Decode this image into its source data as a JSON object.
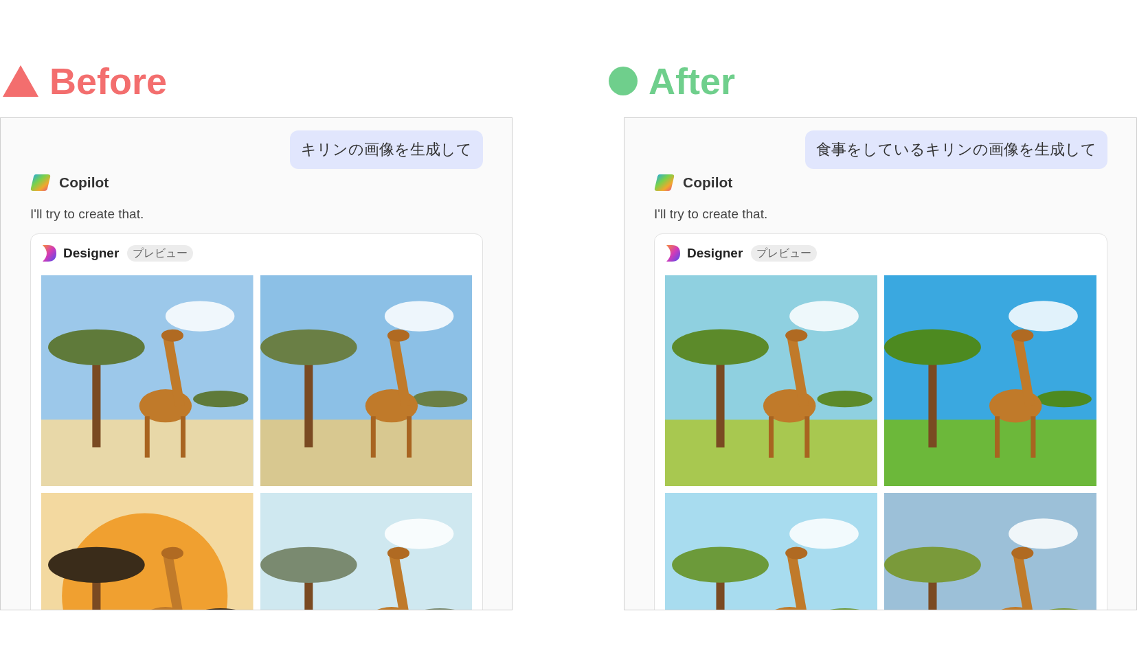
{
  "panels": [
    {
      "heading": "Before",
      "kind": "triangle",
      "color": "#f36e6e",
      "prompt": "キリンの画像を生成して",
      "assistant": "Copilot",
      "reply": "I'll try to create that.",
      "card": {
        "title": "Designer",
        "badge": "プレビュー"
      }
    },
    {
      "heading": "After",
      "kind": "circle",
      "color": "#6fcf8c",
      "prompt": "食事をしているキリンの画像を生成して",
      "assistant": "Copilot",
      "reply": "I'll try to create that.",
      "card": {
        "title": "Designer",
        "badge": "プレビュー"
      }
    }
  ]
}
